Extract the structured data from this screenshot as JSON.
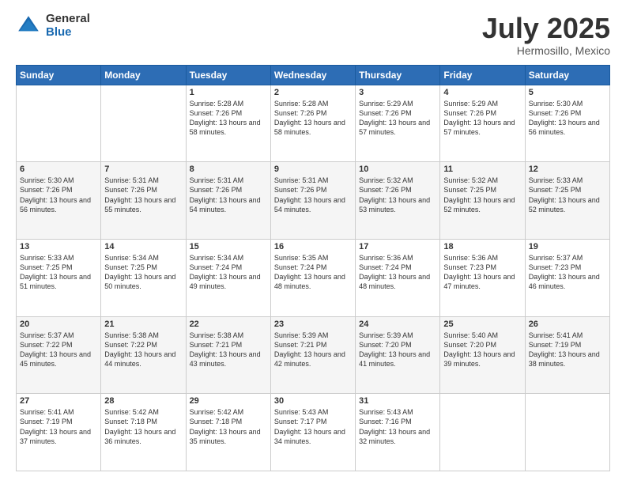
{
  "logo": {
    "general": "General",
    "blue": "Blue"
  },
  "header": {
    "month": "July 2025",
    "location": "Hermosillo, Mexico"
  },
  "days_of_week": [
    "Sunday",
    "Monday",
    "Tuesday",
    "Wednesday",
    "Thursday",
    "Friday",
    "Saturday"
  ],
  "weeks": [
    [
      {
        "day": "",
        "info": ""
      },
      {
        "day": "",
        "info": ""
      },
      {
        "day": "1",
        "info": "Sunrise: 5:28 AM\nSunset: 7:26 PM\nDaylight: 13 hours\nand 58 minutes."
      },
      {
        "day": "2",
        "info": "Sunrise: 5:28 AM\nSunset: 7:26 PM\nDaylight: 13 hours\nand 58 minutes."
      },
      {
        "day": "3",
        "info": "Sunrise: 5:29 AM\nSunset: 7:26 PM\nDaylight: 13 hours\nand 57 minutes."
      },
      {
        "day": "4",
        "info": "Sunrise: 5:29 AM\nSunset: 7:26 PM\nDaylight: 13 hours\nand 57 minutes."
      },
      {
        "day": "5",
        "info": "Sunrise: 5:30 AM\nSunset: 7:26 PM\nDaylight: 13 hours\nand 56 minutes."
      }
    ],
    [
      {
        "day": "6",
        "info": "Sunrise: 5:30 AM\nSunset: 7:26 PM\nDaylight: 13 hours\nand 56 minutes."
      },
      {
        "day": "7",
        "info": "Sunrise: 5:31 AM\nSunset: 7:26 PM\nDaylight: 13 hours\nand 55 minutes."
      },
      {
        "day": "8",
        "info": "Sunrise: 5:31 AM\nSunset: 7:26 PM\nDaylight: 13 hours\nand 54 minutes."
      },
      {
        "day": "9",
        "info": "Sunrise: 5:31 AM\nSunset: 7:26 PM\nDaylight: 13 hours\nand 54 minutes."
      },
      {
        "day": "10",
        "info": "Sunrise: 5:32 AM\nSunset: 7:26 PM\nDaylight: 13 hours\nand 53 minutes."
      },
      {
        "day": "11",
        "info": "Sunrise: 5:32 AM\nSunset: 7:25 PM\nDaylight: 13 hours\nand 52 minutes."
      },
      {
        "day": "12",
        "info": "Sunrise: 5:33 AM\nSunset: 7:25 PM\nDaylight: 13 hours\nand 52 minutes."
      }
    ],
    [
      {
        "day": "13",
        "info": "Sunrise: 5:33 AM\nSunset: 7:25 PM\nDaylight: 13 hours\nand 51 minutes."
      },
      {
        "day": "14",
        "info": "Sunrise: 5:34 AM\nSunset: 7:25 PM\nDaylight: 13 hours\nand 50 minutes."
      },
      {
        "day": "15",
        "info": "Sunrise: 5:34 AM\nSunset: 7:24 PM\nDaylight: 13 hours\nand 49 minutes."
      },
      {
        "day": "16",
        "info": "Sunrise: 5:35 AM\nSunset: 7:24 PM\nDaylight: 13 hours\nand 48 minutes."
      },
      {
        "day": "17",
        "info": "Sunrise: 5:36 AM\nSunset: 7:24 PM\nDaylight: 13 hours\nand 48 minutes."
      },
      {
        "day": "18",
        "info": "Sunrise: 5:36 AM\nSunset: 7:23 PM\nDaylight: 13 hours\nand 47 minutes."
      },
      {
        "day": "19",
        "info": "Sunrise: 5:37 AM\nSunset: 7:23 PM\nDaylight: 13 hours\nand 46 minutes."
      }
    ],
    [
      {
        "day": "20",
        "info": "Sunrise: 5:37 AM\nSunset: 7:22 PM\nDaylight: 13 hours\nand 45 minutes."
      },
      {
        "day": "21",
        "info": "Sunrise: 5:38 AM\nSunset: 7:22 PM\nDaylight: 13 hours\nand 44 minutes."
      },
      {
        "day": "22",
        "info": "Sunrise: 5:38 AM\nSunset: 7:21 PM\nDaylight: 13 hours\nand 43 minutes."
      },
      {
        "day": "23",
        "info": "Sunrise: 5:39 AM\nSunset: 7:21 PM\nDaylight: 13 hours\nand 42 minutes."
      },
      {
        "day": "24",
        "info": "Sunrise: 5:39 AM\nSunset: 7:20 PM\nDaylight: 13 hours\nand 41 minutes."
      },
      {
        "day": "25",
        "info": "Sunrise: 5:40 AM\nSunset: 7:20 PM\nDaylight: 13 hours\nand 39 minutes."
      },
      {
        "day": "26",
        "info": "Sunrise: 5:41 AM\nSunset: 7:19 PM\nDaylight: 13 hours\nand 38 minutes."
      }
    ],
    [
      {
        "day": "27",
        "info": "Sunrise: 5:41 AM\nSunset: 7:19 PM\nDaylight: 13 hours\nand 37 minutes."
      },
      {
        "day": "28",
        "info": "Sunrise: 5:42 AM\nSunset: 7:18 PM\nDaylight: 13 hours\nand 36 minutes."
      },
      {
        "day": "29",
        "info": "Sunrise: 5:42 AM\nSunset: 7:18 PM\nDaylight: 13 hours\nand 35 minutes."
      },
      {
        "day": "30",
        "info": "Sunrise: 5:43 AM\nSunset: 7:17 PM\nDaylight: 13 hours\nand 34 minutes."
      },
      {
        "day": "31",
        "info": "Sunrise: 5:43 AM\nSunset: 7:16 PM\nDaylight: 13 hours\nand 32 minutes."
      },
      {
        "day": "",
        "info": ""
      },
      {
        "day": "",
        "info": ""
      }
    ]
  ]
}
